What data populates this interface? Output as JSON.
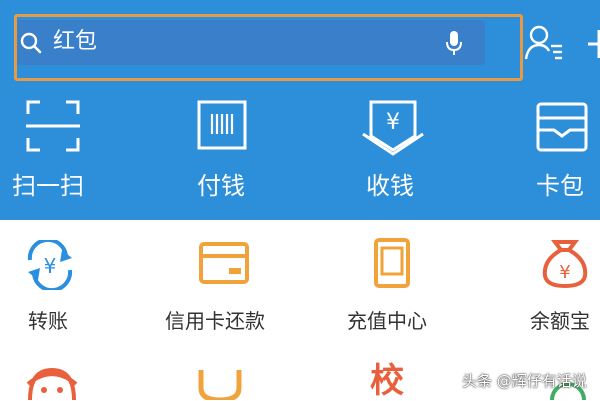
{
  "search": {
    "text": "红包"
  },
  "quick_actions": [
    {
      "label": "扫一扫",
      "icon": "scan-icon"
    },
    {
      "label": "付钱",
      "icon": "barcode-icon"
    },
    {
      "label": "收钱",
      "icon": "receive-money-icon"
    },
    {
      "label": "卡包",
      "icon": "card-wallet-icon"
    }
  ],
  "services": [
    {
      "label": "转账",
      "icon": "transfer-icon",
      "color": "#2b8fe0"
    },
    {
      "label": "信用卡还款",
      "icon": "credit-card-icon",
      "color": "#f0a33a"
    },
    {
      "label": "充值中心",
      "icon": "phone-recharge-icon",
      "color": "#f0a33a"
    },
    {
      "label": "余额宝",
      "icon": "money-bag-icon",
      "color": "#e8603c"
    }
  ],
  "second_row": [
    {
      "text": "校",
      "color": "#e8603c"
    }
  ],
  "watermark": "头条 @辉仔有话说"
}
